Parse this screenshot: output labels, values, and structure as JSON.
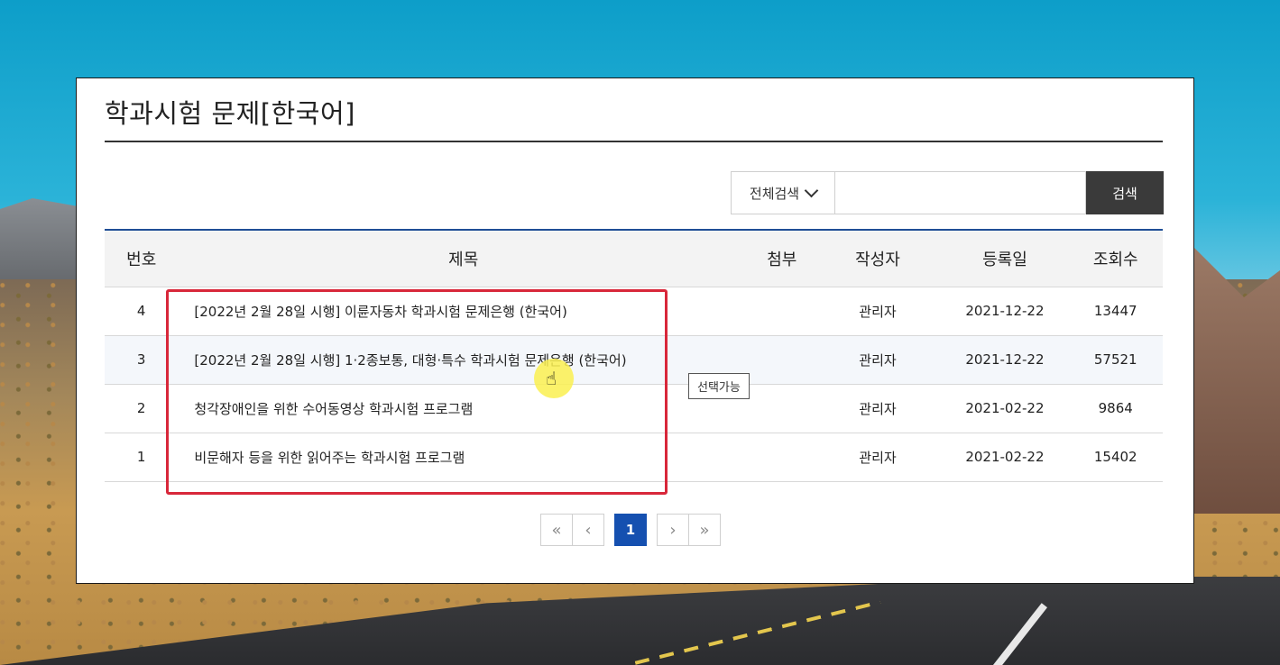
{
  "page": {
    "title": "학과시험 문제[한국어]"
  },
  "search": {
    "scope_label": "전체검색",
    "input_value": "",
    "button_label": "검색"
  },
  "table": {
    "headers": {
      "number": "번호",
      "title": "제목",
      "attachment": "첨부",
      "author": "작성자",
      "date": "등록일",
      "views": "조회수"
    },
    "rows": [
      {
        "number": "4",
        "title": "[2022년 2월 28일 시행] 이륜자동차 학과시험 문제은행 (한국어)",
        "attachment": "",
        "author": "관리자",
        "date": "2021-12-22",
        "views": "13447"
      },
      {
        "number": "3",
        "title": "[2022년 2월 28일 시행] 1·2종보통, 대형·특수 학과시험 문제은행 (한국어)",
        "attachment": "",
        "author": "관리자",
        "date": "2021-12-22",
        "views": "57521"
      },
      {
        "number": "2",
        "title": "청각장애인을 위한 수어동영상 학과시험 프로그램",
        "attachment": "",
        "author": "관리자",
        "date": "2021-02-22",
        "views": "9864"
      },
      {
        "number": "1",
        "title": "비문해자 등을 위한 읽어주는 학과시험 프로그램",
        "attachment": "",
        "author": "관리자",
        "date": "2021-02-22",
        "views": "15402"
      }
    ]
  },
  "tooltip": {
    "text": "선택가능"
  },
  "pagination": {
    "first": "«",
    "prev": "‹",
    "current": "1",
    "next": "›",
    "last": "»"
  },
  "colors": {
    "accent": "#1550b0",
    "highlight_box": "#d8273a",
    "cursor_glow": "#faf050"
  }
}
